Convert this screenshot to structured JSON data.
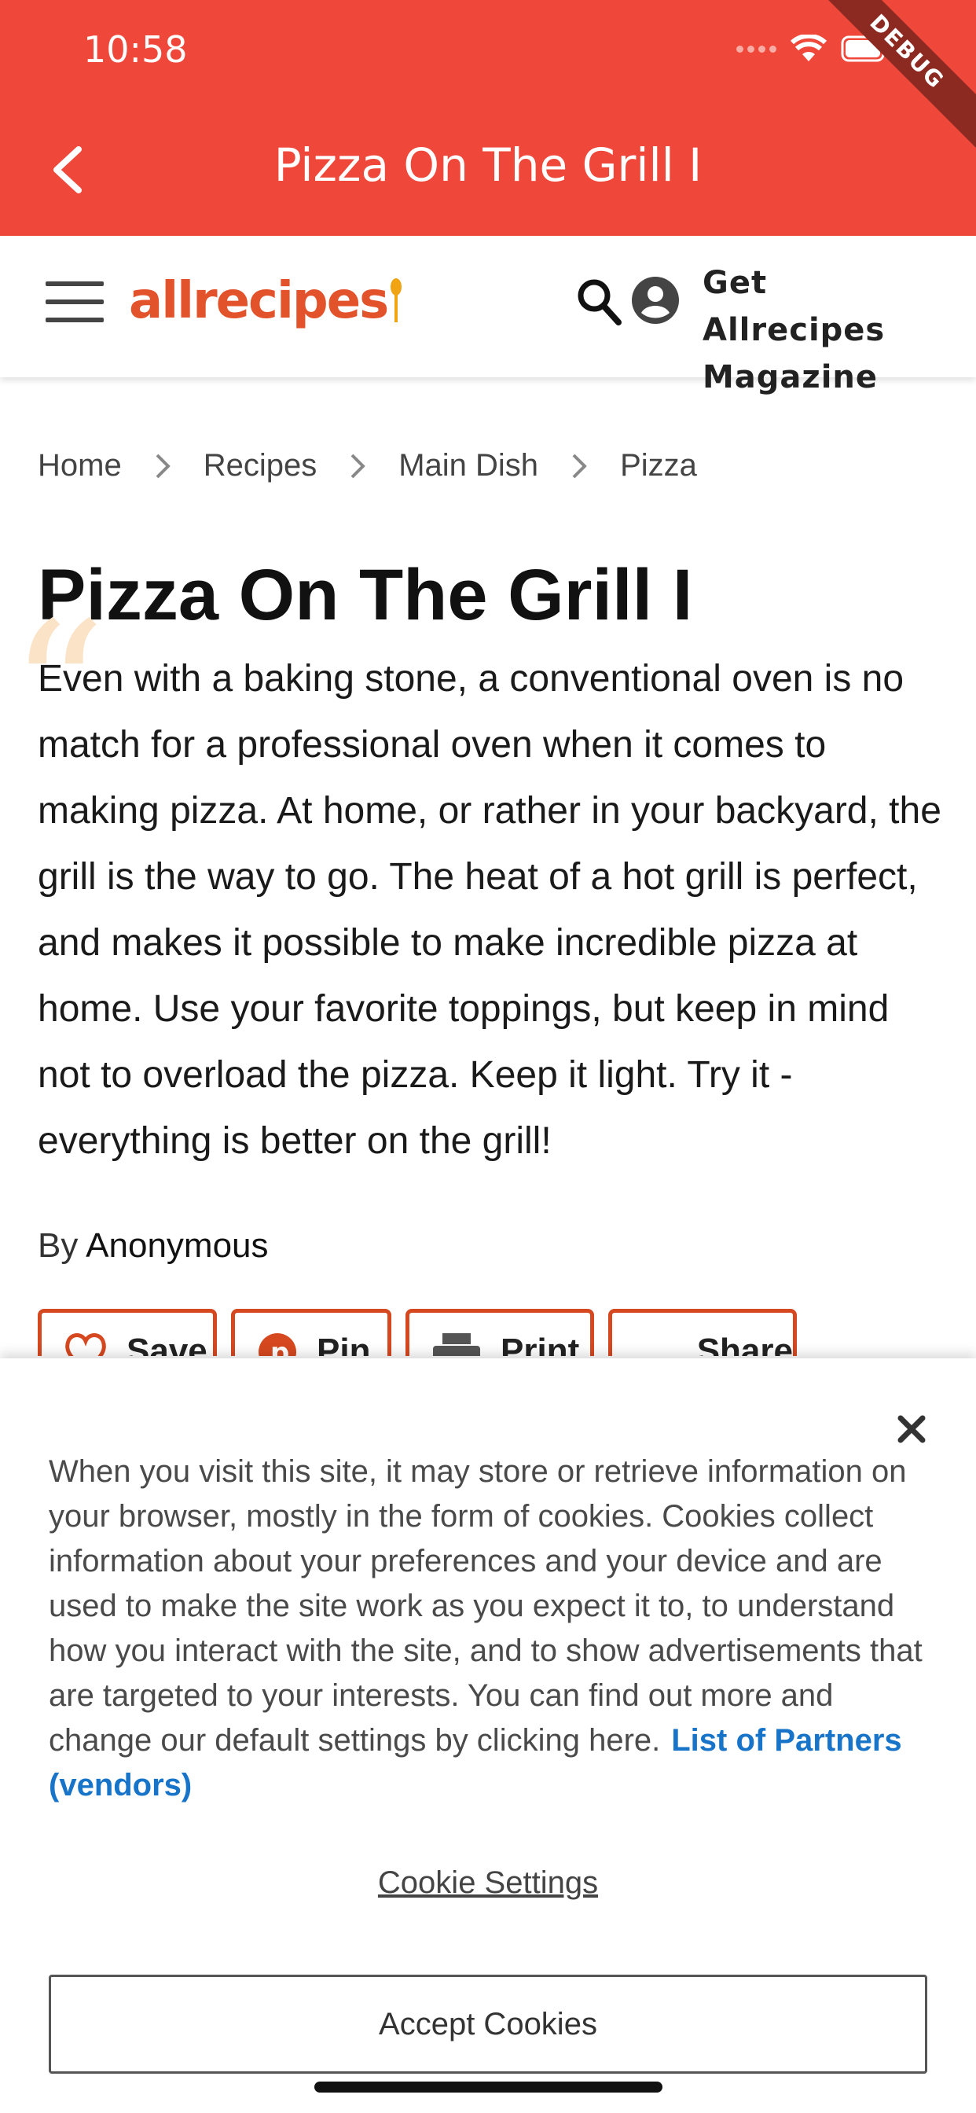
{
  "status_bar": {
    "time": "10:58",
    "debug_label": "DEBUG"
  },
  "app_bar": {
    "title": "Pizza On The Grill I",
    "back_icon": "chevron-left-icon"
  },
  "site_header": {
    "logo_text": "allrecipes",
    "magazine_line1": "Get Allrecipes",
    "magazine_line2": "Magazine"
  },
  "breadcrumb": [
    "Home",
    "Recipes",
    "Main Dish",
    "Pizza"
  ],
  "article": {
    "title": "Pizza On The Grill I",
    "quote_glyph": "“",
    "description": "Even with a baking stone, a conventional oven is no match for a professional oven when it comes to making pizza. At home, or rather in your backyard, the grill is the way to go. The heat of a hot grill is perfect, and makes it possible to make incredible pizza at home. Use your favorite toppings, but keep in mind not to overload the pizza. Keep it light. Try it - everything is better on the grill!",
    "byline_prefix": "By",
    "author": "Anonymous",
    "actions": [
      {
        "label": "Save",
        "icon": "heart-icon"
      },
      {
        "label": "Pin",
        "icon": "pinterest-icon"
      },
      {
        "label": "Print",
        "icon": "printer-icon"
      },
      {
        "label": "Share",
        "icon": "more-dots-icon"
      }
    ]
  },
  "cookie_banner": {
    "text": "When you visit this site, it may store or retrieve information on your browser, mostly in the form of cookies. Cookies collect information about your preferences and your device and are used to make the site work as you expect it to, to understand how you interact with the site, and to show advertisements that are targeted to your interests. You can find out more and change our default settings by clicking here.",
    "partners_link": "List of Partners (vendors)",
    "settings_link": "Cookie Settings",
    "accept_label": "Accept Cookies"
  },
  "colors": {
    "app_bar": "#ef473a",
    "brand_orange": "#e2522b",
    "action_border": "#d6481f",
    "link_blue": "#1874c8"
  }
}
